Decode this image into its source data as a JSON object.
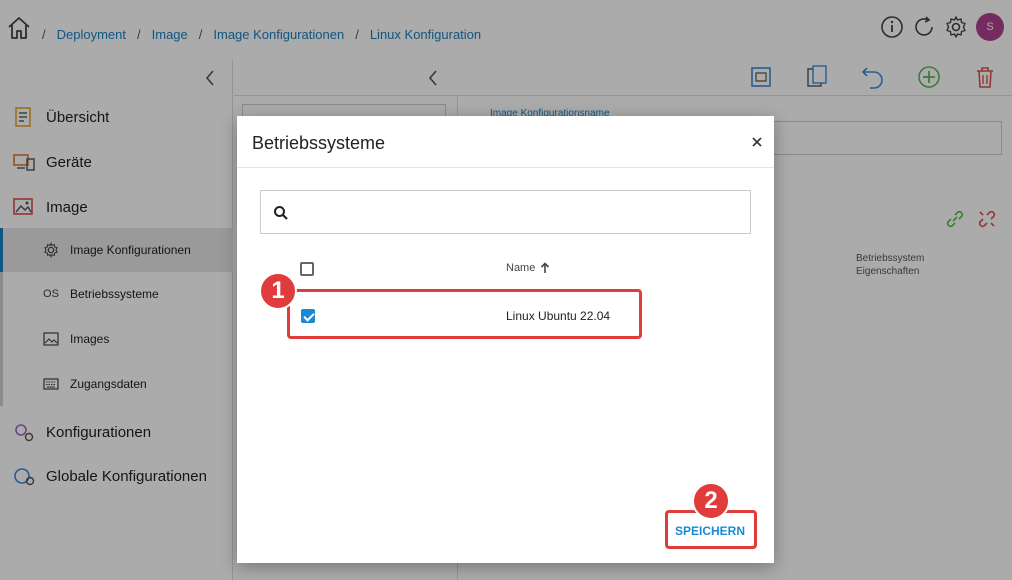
{
  "breadcrumb": {
    "items": [
      "Deployment",
      "Image",
      "Image Konfigurationen",
      "Linux Konfiguration"
    ],
    "separator": "/"
  },
  "user": {
    "avatar_initial": "S"
  },
  "sidebar": {
    "items": [
      {
        "label": "Übersicht",
        "icon": "overview-icon"
      },
      {
        "label": "Geräte",
        "icon": "devices-icon"
      },
      {
        "label": "Image",
        "icon": "image-icon"
      }
    ],
    "sub_items": [
      {
        "label": "Image Konfigurationen",
        "icon": "gear-icon"
      },
      {
        "label": "Betriebssysteme",
        "icon_text": "OS"
      },
      {
        "label": "Images",
        "icon": "picture-icon"
      },
      {
        "label": "Zugangsdaten",
        "icon": "keyboard-icon"
      }
    ],
    "bottom_items": [
      {
        "label": "Konfigurationen",
        "icon": "gears-icon"
      },
      {
        "label": "Globale Konfigurationen",
        "icon": "globe-gears-icon"
      }
    ]
  },
  "main": {
    "form_label": "Image Konfigurationsname",
    "column_header_line1": "Betriebssystem",
    "column_header_line2": "Eigenschaften"
  },
  "modal": {
    "title": "Betriebssysteme",
    "search_placeholder": "",
    "table": {
      "column_name": "Name",
      "rows": [
        {
          "name": "Linux Ubuntu 22.04",
          "checked": true
        }
      ]
    },
    "save_label": "SPEICHERN"
  },
  "annotations": {
    "badge1": "1",
    "badge2": "2",
    "color": "#e03c3c"
  },
  "colors": {
    "accent": "#1a7fc1",
    "avatar": "#b0418f"
  }
}
